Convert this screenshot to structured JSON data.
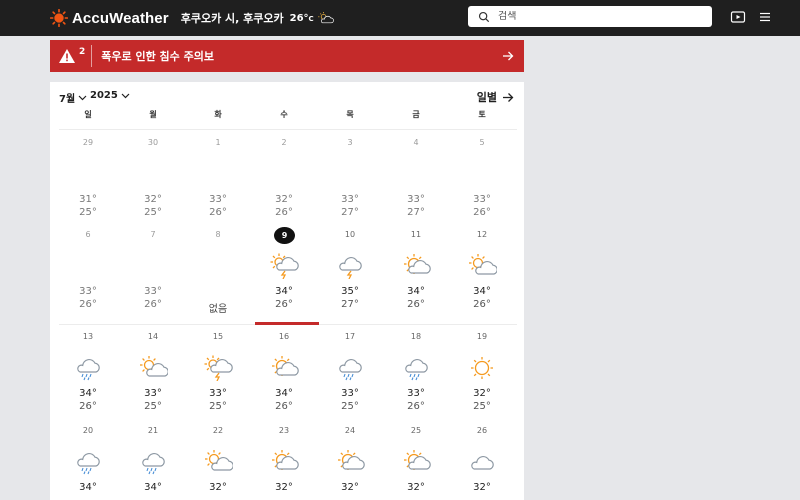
{
  "header": {
    "logo_text": "AccuWeather",
    "location": "후쿠오카 시, 후쿠오카",
    "current_temp": "26°",
    "current_temp_unit": "C",
    "current_icon": "partly-cloudy-icon",
    "search_placeholder": "검색"
  },
  "alert": {
    "count": "2",
    "text": "폭우로 인한 침수 주의보"
  },
  "calendar": {
    "month": "7월",
    "year": "2025",
    "daily_link": "일별",
    "weekdays": [
      "일",
      "월",
      "화",
      "수",
      "목",
      "금",
      "토"
    ],
    "weeks": [
      {
        "days": [
          {
            "date": "29",
            "hi": "31°",
            "lo": "25°",
            "icon": "none",
            "past": true
          },
          {
            "date": "30",
            "hi": "32°",
            "lo": "25°",
            "icon": "none",
            "past": true
          },
          {
            "date": "1",
            "hi": "33°",
            "lo": "26°",
            "icon": "none",
            "past": true
          },
          {
            "date": "2",
            "hi": "32°",
            "lo": "26°",
            "icon": "none",
            "past": true
          },
          {
            "date": "3",
            "hi": "33°",
            "lo": "27°",
            "icon": "none",
            "past": true
          },
          {
            "date": "4",
            "hi": "33°",
            "lo": "27°",
            "icon": "none",
            "past": true
          },
          {
            "date": "5",
            "hi": "33°",
            "lo": "26°",
            "icon": "none",
            "past": true
          }
        ]
      },
      {
        "days": [
          {
            "date": "6",
            "hi": "33°",
            "lo": "26°",
            "icon": "none",
            "past": true
          },
          {
            "date": "7",
            "hi": "33°",
            "lo": "26°",
            "icon": "none",
            "past": true
          },
          {
            "date": "8",
            "na": "없음",
            "icon": "none",
            "past": true
          },
          {
            "date": "9",
            "hi": "34°",
            "lo": "26°",
            "icon": "sun-thunder-icon",
            "today": true
          },
          {
            "date": "10",
            "hi": "35°",
            "lo": "27°",
            "icon": "cloud-thunder-icon"
          },
          {
            "date": "11",
            "hi": "34°",
            "lo": "26°",
            "icon": "sun-cloud-icon"
          },
          {
            "date": "12",
            "hi": "34°",
            "lo": "26°",
            "icon": "partly-cloudy-icon"
          }
        ]
      },
      {
        "days": [
          {
            "date": "13",
            "hi": "34°",
            "lo": "26°",
            "icon": "rain-icon"
          },
          {
            "date": "14",
            "hi": "33°",
            "lo": "25°",
            "icon": "partly-cloudy-icon"
          },
          {
            "date": "15",
            "hi": "33°",
            "lo": "25°",
            "icon": "sun-thunder-icon"
          },
          {
            "date": "16",
            "hi": "34°",
            "lo": "26°",
            "icon": "sun-cloud-icon"
          },
          {
            "date": "17",
            "hi": "33°",
            "lo": "25°",
            "icon": "rain-icon"
          },
          {
            "date": "18",
            "hi": "33°",
            "lo": "26°",
            "icon": "rain-icon"
          },
          {
            "date": "19",
            "hi": "32°",
            "lo": "25°",
            "icon": "sunny-icon"
          }
        ]
      },
      {
        "days": [
          {
            "date": "20",
            "hi": "34°",
            "lo": "",
            "icon": "rain-icon"
          },
          {
            "date": "21",
            "hi": "34°",
            "lo": "",
            "icon": "rain-icon"
          },
          {
            "date": "22",
            "hi": "32°",
            "lo": "",
            "icon": "partly-cloudy-icon"
          },
          {
            "date": "23",
            "hi": "32°",
            "lo": "",
            "icon": "sun-cloud-icon"
          },
          {
            "date": "24",
            "hi": "32°",
            "lo": "",
            "icon": "sun-cloud-icon"
          },
          {
            "date": "25",
            "hi": "32°",
            "lo": "",
            "icon": "sun-cloud-icon"
          },
          {
            "date": "26",
            "hi": "32°",
            "lo": "",
            "icon": "cloudy-icon"
          }
        ]
      }
    ]
  },
  "colors": {
    "topbar": "#1f1f1f",
    "alert": "#c42a2a",
    "accent_orange": "#f59a1f",
    "today_bar": "#c42a2a"
  }
}
